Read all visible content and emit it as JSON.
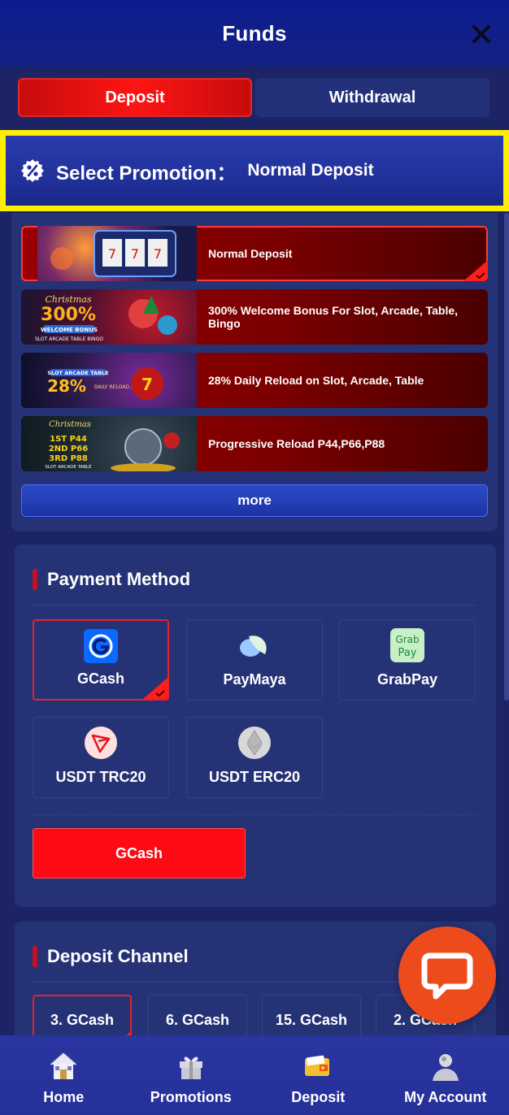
{
  "header": {
    "title": "Funds"
  },
  "tabs": [
    {
      "label": "Deposit",
      "active": true
    },
    {
      "label": "Withdrawal",
      "active": false
    }
  ],
  "promotion_selector": {
    "label": "Select Promotion：",
    "value": "Normal Deposit"
  },
  "promotions": [
    {
      "title": "Normal Deposit",
      "selected": true
    },
    {
      "title": "300% Welcome Bonus For Slot, Arcade, Table, Bingo",
      "selected": false,
      "thumb_text": [
        "Christmas",
        "300%",
        "WELCOME BONUS",
        "SLOT ARCADE TABLE BINGO"
      ]
    },
    {
      "title": "28% Daily Reload on Slot, Arcade, Table",
      "selected": false,
      "thumb_text": [
        "SLOT ARCADE TABLE",
        "28%",
        "DAILY RELOAD BONUS"
      ]
    },
    {
      "title": "Progressive Reload P44,P66,P88",
      "selected": false,
      "thumb_text": [
        "Christmas",
        "1ST P44",
        "2ND P66",
        "3RD P88",
        "SLOT ARCADE TABLE"
      ]
    }
  ],
  "more_label": "more",
  "payment_method": {
    "title": "Payment Method",
    "options": [
      {
        "label": "GCash",
        "icon": "gcash-icon",
        "selected": true
      },
      {
        "label": "PayMaya",
        "icon": "paymaya-icon",
        "selected": false
      },
      {
        "label": "GrabPay",
        "icon": "grabpay-icon",
        "selected": false,
        "icon_text": [
          "Grab",
          "Pay"
        ]
      },
      {
        "label": "USDT TRC20",
        "icon": "tron-icon",
        "selected": false
      },
      {
        "label": "USDT ERC20",
        "icon": "ethereum-icon",
        "selected": false
      }
    ],
    "selected_button": "GCash"
  },
  "deposit_channel": {
    "title": "Deposit Channel",
    "channels": [
      {
        "label": "3. GCash",
        "selected": true
      },
      {
        "label": "6. GCash",
        "selected": false
      },
      {
        "label": "15. GCash",
        "selected": false
      },
      {
        "label": "2. GCash",
        "selected": false
      }
    ]
  },
  "bottom_nav": [
    {
      "label": "Home",
      "icon": "home-icon"
    },
    {
      "label": "Promotions",
      "icon": "gift-icon"
    },
    {
      "label": "Deposit",
      "icon": "wallet-icon"
    },
    {
      "label": "My Account",
      "icon": "account-icon"
    }
  ],
  "colors": {
    "background": "#1d2466",
    "header": "#0d1c8f",
    "accent_red": "#ff0a14",
    "highlight_yellow": "#ffee00",
    "chat": "#ee4b1c"
  }
}
